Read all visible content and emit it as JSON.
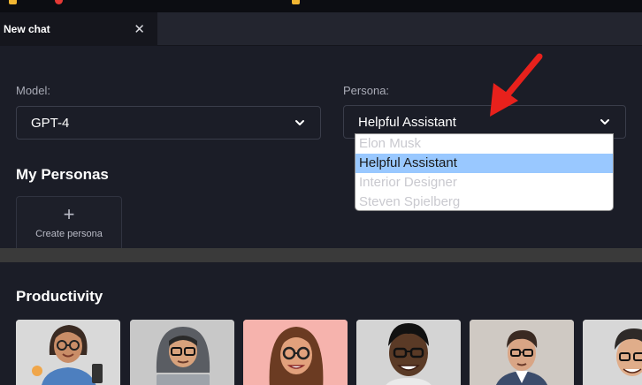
{
  "tab": {
    "title": "New chat",
    "close_glyph": "✕"
  },
  "model": {
    "label": "Model:",
    "value": "GPT-4"
  },
  "persona": {
    "label": "Persona:",
    "value": "Helpful Assistant",
    "options": [
      "Elon Musk",
      "Helpful Assistant",
      "Interior Designer",
      "Steven Spielberg"
    ],
    "selected_index": 1
  },
  "my_personas": {
    "title": "My Personas",
    "create_glyph": "+",
    "create_label": "Create persona"
  },
  "productivity": {
    "title": "Productivity",
    "cards": [
      {
        "icon": "avatar-woman-glasses-icon",
        "bg": "#d9d9d9"
      },
      {
        "icon": "avatar-hooded-laptop-icon",
        "bg": "#c8c8c8"
      },
      {
        "icon": "avatar-woman-pink-icon",
        "bg": "#f6b3ad"
      },
      {
        "icon": "avatar-man-dark-icon",
        "bg": "#d4d4d4"
      },
      {
        "icon": "avatar-man-suit-icon",
        "bg": "#cfc9c3"
      },
      {
        "icon": "avatar-man-partial-icon",
        "bg": "#d7d7d7"
      }
    ]
  },
  "colors": {
    "arrow": "#e8211c",
    "highlight": "#99c8ff",
    "bg": "#1b1d27"
  }
}
